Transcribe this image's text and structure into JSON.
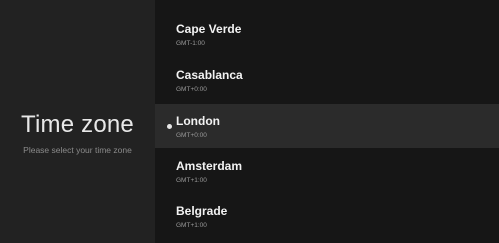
{
  "left": {
    "title": "Time zone",
    "subtitle": "Please select your time zone"
  },
  "timezones": [
    {
      "name": "Cape Verde",
      "offset": "GMT-1:00",
      "selected": false
    },
    {
      "name": "Casablanca",
      "offset": "GMT+0:00",
      "selected": false
    },
    {
      "name": "London",
      "offset": "GMT+0:00",
      "selected": true
    },
    {
      "name": "Amsterdam",
      "offset": "GMT+1:00",
      "selected": false
    },
    {
      "name": "Belgrade",
      "offset": "GMT+1:00",
      "selected": false
    }
  ],
  "colors": {
    "left_panel": "#222222",
    "right_panel": "#161616",
    "selected_row": "#2b2b2b",
    "text_primary": "#f2f2f2",
    "text_secondary": "#9a9a9a"
  }
}
